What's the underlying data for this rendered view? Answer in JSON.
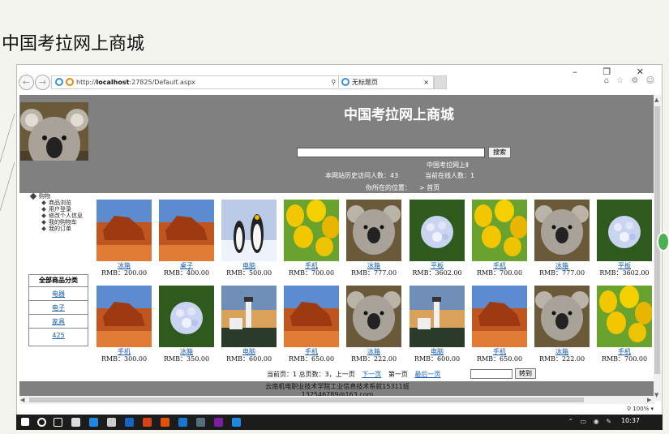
{
  "slide": {
    "title": "中国考拉网上商城"
  },
  "browser": {
    "url_host": "localhost",
    "url_rest": ":27825/Default.aspx",
    "url_prefix": "http://",
    "tab_title": "无标题页",
    "tab_close": "×",
    "search_tools": "⚲ ▾ ↻",
    "window_controls": "– ❐ ✕",
    "right_icons": "⌂ ☆ ⚙ ☺",
    "zoom": "100%"
  },
  "site": {
    "title": "中国考拉网上商城",
    "search_label": "搜索",
    "marquee": "中国考拉网上Ⅱ",
    "visits_label": "本网站历史访问人数：",
    "visits_value": "43",
    "online_label": "当前在线人数：",
    "online_value": "1",
    "crumb_label": "你所在的位置：",
    "crumb_link": "> 首页"
  },
  "tree": {
    "root": "购物",
    "children": [
      "商品浏览",
      "用户登录",
      "修改个人信息",
      "我的购物车",
      "我的订单"
    ]
  },
  "categories": {
    "header": "全部商品分类",
    "items": [
      "电器",
      "电子",
      "家具",
      "425"
    ]
  },
  "products": [
    {
      "name": "冰箱",
      "price": "RMB：200.00",
      "img": "desert"
    },
    {
      "name": "桌子",
      "price": "RMB：400.00",
      "img": "desert"
    },
    {
      "name": "电脑",
      "price": "RMB：500.00",
      "img": "penguins"
    },
    {
      "name": "手机",
      "price": "RMB：700.00",
      "img": "tulips"
    },
    {
      "name": "冰箱",
      "price": "RMB：777.00",
      "img": "koala"
    },
    {
      "name": "平板",
      "price": "RMB：3602.00",
      "img": "hydrangea"
    },
    {
      "name": "手机",
      "price": "RMB：700.00",
      "img": "tulips"
    },
    {
      "name": "冰箱",
      "price": "RMB：777.00",
      "img": "koala"
    },
    {
      "name": "平板",
      "price": "RMB：3602.00",
      "img": "hydrangea"
    },
    {
      "name": "手机",
      "price": "RMB：300.00",
      "img": "desert"
    },
    {
      "name": "冰箱",
      "price": "RMB：350.00",
      "img": "hydrangea"
    },
    {
      "name": "电脑",
      "price": "RMB：600.00",
      "img": "lighthouse"
    },
    {
      "name": "手机",
      "price": "RMB：650.00",
      "img": "desert"
    },
    {
      "name": "冰箱",
      "price": "RMB：222.00",
      "img": "koala"
    },
    {
      "name": "电脑",
      "price": "RMB：600.00",
      "img": "lighthouse"
    },
    {
      "name": "手机",
      "price": "RMB：650.00",
      "img": "desert"
    },
    {
      "name": "冰箱",
      "price": "RMB：222.00",
      "img": "koala"
    },
    {
      "name": "手机",
      "price": "RMB：700.00",
      "img": "tulips"
    }
  ],
  "pager": {
    "current": "当前页：1",
    "total": "总页数：3，",
    "prev": "上一页",
    "next": "下一页",
    "first": "第一页",
    "last": "最后一页",
    "goto": "转到"
  },
  "footer": {
    "line1": "云南机电职业技术学院工业信息技术系就15311班",
    "line2": "132546789@163.com"
  },
  "taskbar": {
    "time": "10:37",
    "tray": "⌃ ▭ ◉ ✎"
  }
}
